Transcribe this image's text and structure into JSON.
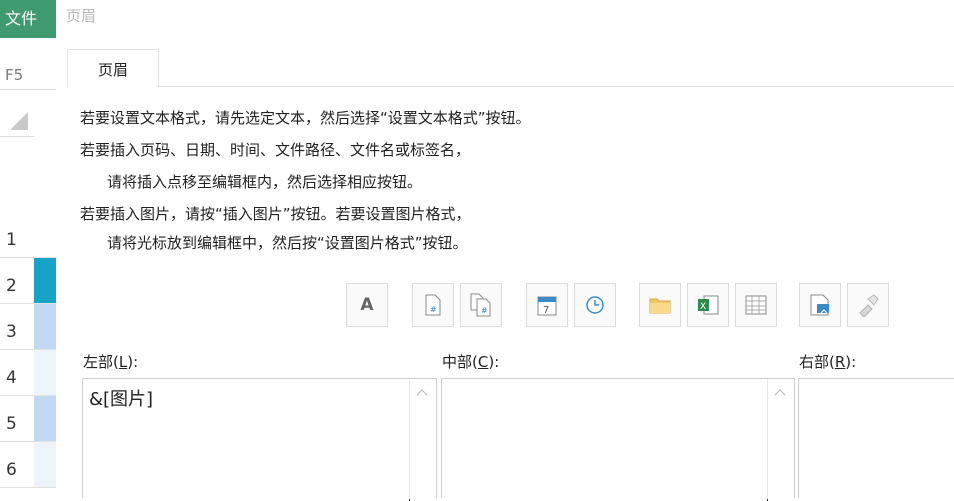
{
  "sheet": {
    "file_tab": "文件",
    "cell_ref": "F5",
    "rows": [
      "1",
      "2",
      "3",
      "4",
      "5",
      "6"
    ],
    "row_colors": [
      "#ffffff",
      "#17a2c8",
      "#c1d9f2",
      "#eef4fb",
      "#c1d9f2",
      "#eef4fb"
    ]
  },
  "dialog": {
    "title": "页眉",
    "tab_label": "页眉",
    "instructions": [
      "若要设置文本格式，请先选定文本，然后选择“设置文本格式”按钮。",
      "若要插入页码、日期、时间、文件路径、文件名或标签名，",
      "请将插入点移至编辑框内，然后选择相应按钮。",
      "若要插入图片，请按“插入图片”按钮。若要设置图片格式，",
      "请将光标放到编辑框中，然后按“设置图片格式”按钮。"
    ],
    "toolbar": {
      "format_text_glyph": "A",
      "icons": [
        "format-text-icon",
        "page-number-icon",
        "page-count-icon",
        "date-icon",
        "time-icon",
        "file-path-icon",
        "file-name-icon",
        "sheet-name-icon",
        "insert-picture-icon",
        "format-picture-icon"
      ]
    },
    "left": {
      "label": "左部(",
      "key": "L",
      "label_end": "):",
      "content": "&[图片]"
    },
    "center": {
      "label": "中部(",
      "key": "C",
      "label_end": "):",
      "content": ""
    },
    "right": {
      "label": "右部(",
      "key": "R",
      "label_end": "):",
      "content": ""
    }
  }
}
